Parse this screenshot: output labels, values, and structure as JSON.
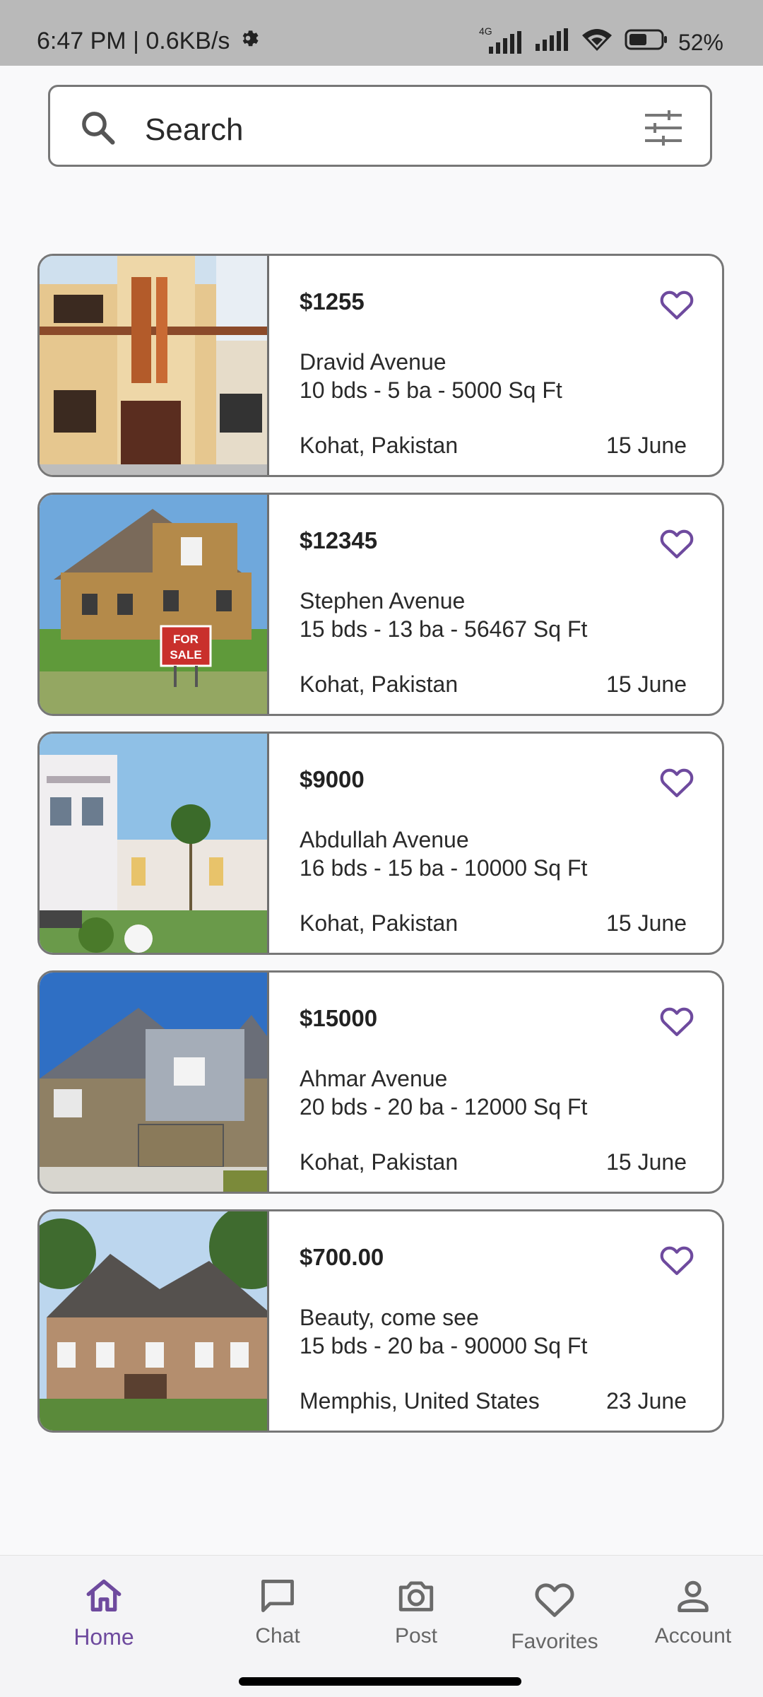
{
  "status": {
    "time_speed": "6:47 PM | 0.6KB/s",
    "network": "4G",
    "battery": "52%"
  },
  "search": {
    "placeholder": "Search"
  },
  "listings": [
    {
      "price": "$1255",
      "street": "Dravid Avenue",
      "specs": "10 bds - 5 ba - 5000 Sq Ft",
      "location": "Kohat, Pakistan",
      "date": "15 June"
    },
    {
      "price": "$12345",
      "street": "Stephen Avenue",
      "specs": "15 bds - 13 ba - 56467 Sq Ft",
      "location": "Kohat, Pakistan",
      "date": "15 June",
      "sign": "FOR SALE"
    },
    {
      "price": "$9000",
      "street": "Abdullah Avenue",
      "specs": "16 bds - 15 ba - 10000 Sq Ft",
      "location": "Kohat, Pakistan",
      "date": "15 June"
    },
    {
      "price": "$15000",
      "street": "Ahmar Avenue",
      "specs": "20 bds - 20 ba - 12000 Sq Ft",
      "location": "Kohat, Pakistan",
      "date": "15 June"
    },
    {
      "price": "$700.00",
      "street": "Beauty, come see",
      "specs": "15 bds - 20 ba - 90000 Sq Ft",
      "location": "Memphis, United States",
      "date": "23 June"
    }
  ],
  "nav": {
    "home": "Home",
    "chat": "Chat",
    "post": "Post",
    "favorites": "Favorites",
    "account": "Account"
  },
  "colors": {
    "accent": "#6e4a9e",
    "card_border": "#777777"
  }
}
